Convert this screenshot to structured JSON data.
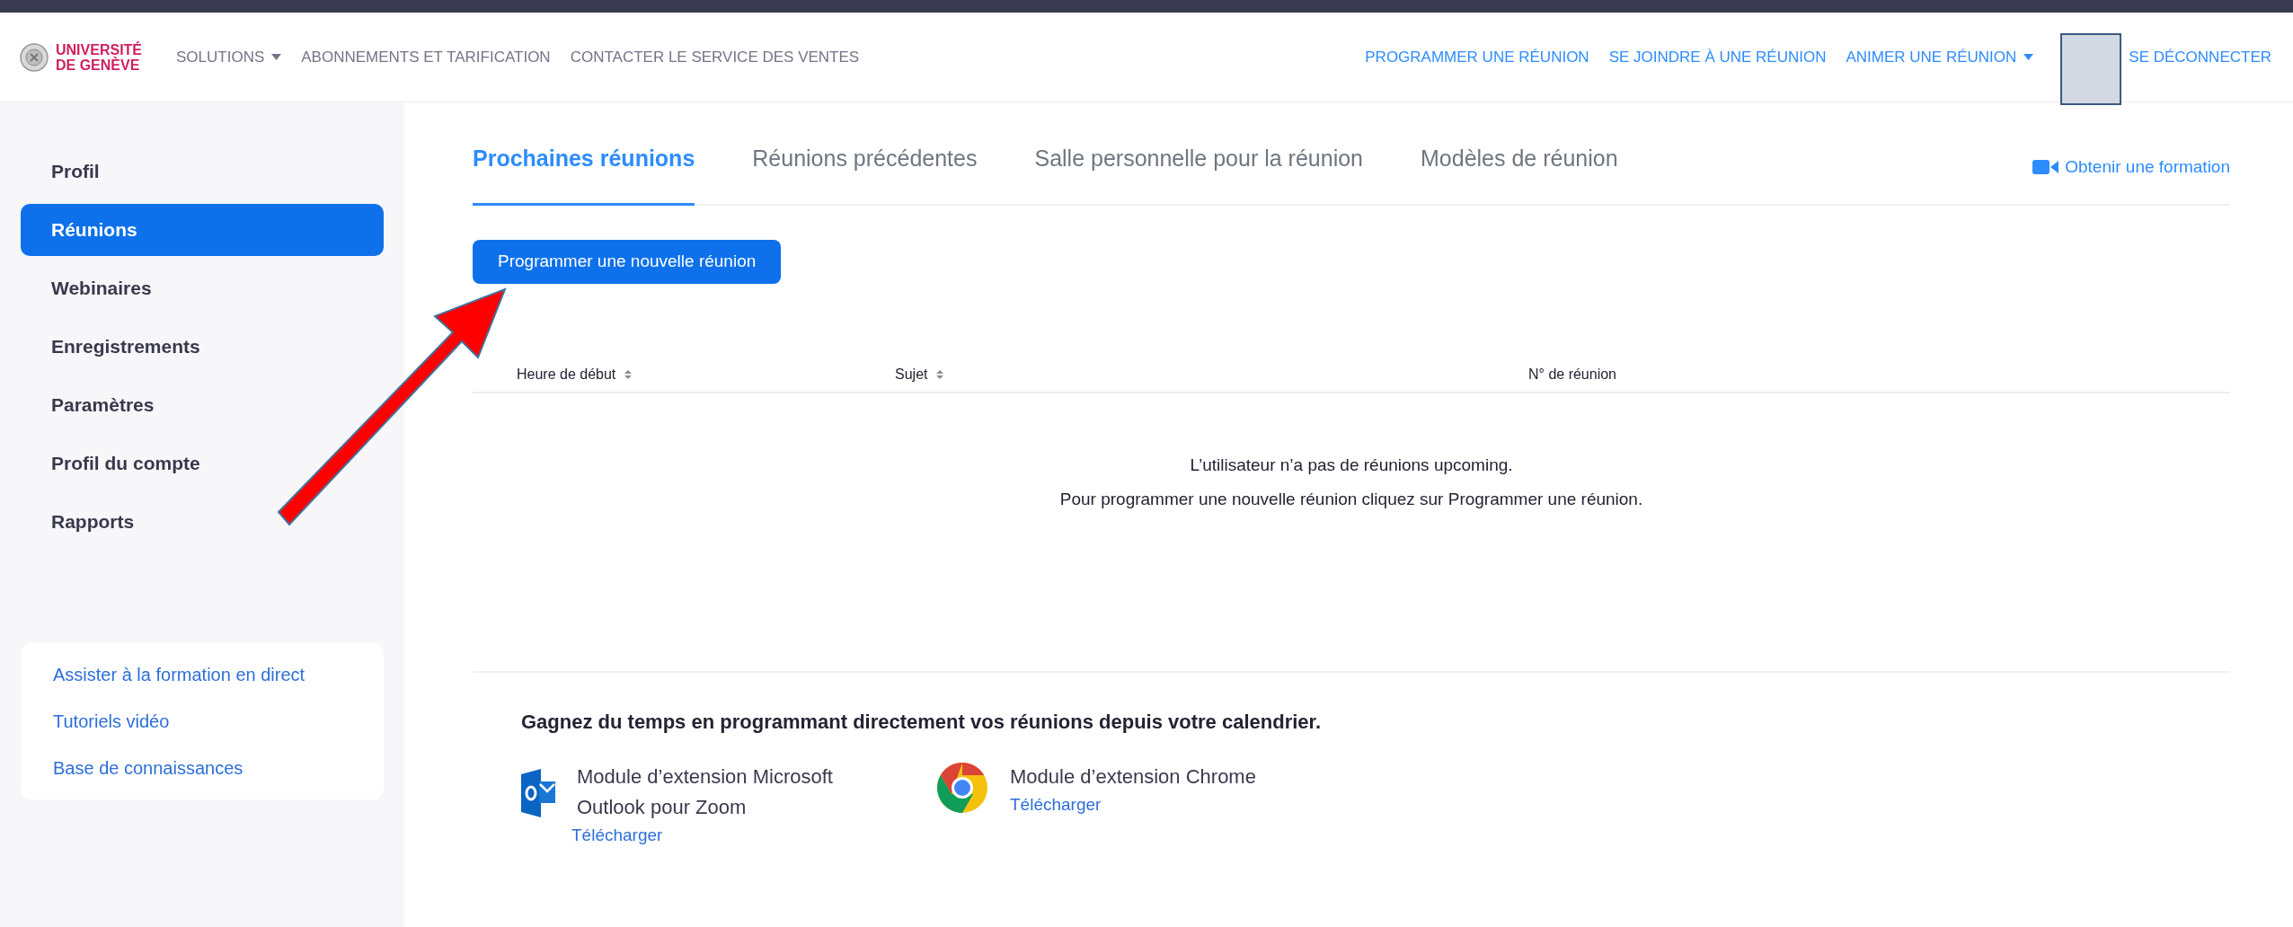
{
  "header": {
    "logo": [
      "UNIVERSITÉ",
      "DE GENÈVE"
    ],
    "left_nav": [
      {
        "label": "SOLUTIONS",
        "dropdown": true
      },
      {
        "label": "ABONNEMENTS ET TARIFICATION",
        "dropdown": false
      },
      {
        "label": "CONTACTER LE SERVICE DES VENTES",
        "dropdown": false
      }
    ],
    "right_nav": [
      {
        "label": "PROGRAMMER UNE RÉUNION",
        "dropdown": false
      },
      {
        "label": "SE JOINDRE À UNE RÉUNION",
        "dropdown": false
      },
      {
        "label": "ANIMER UNE RÉUNION",
        "dropdown": true
      }
    ],
    "signout": "SE DÉCONNECTER"
  },
  "sidebar": {
    "items": [
      {
        "label": "Profil",
        "selected": false
      },
      {
        "label": "Réunions",
        "selected": true
      },
      {
        "label": "Webinaires",
        "selected": false
      },
      {
        "label": "Enregistrements",
        "selected": false
      },
      {
        "label": "Paramètres",
        "selected": false
      },
      {
        "label": "Profil du compte",
        "selected": false
      },
      {
        "label": "Rapports",
        "selected": false
      }
    ],
    "help_links": [
      "Assister à la formation en direct",
      "Tutoriels vidéo",
      "Base de connaissances"
    ]
  },
  "tabs": [
    {
      "label": "Prochaines réunions",
      "selected": true
    },
    {
      "label": "Réunions précédentes",
      "selected": false
    },
    {
      "label": "Salle personnelle pour la réunion",
      "selected": false
    },
    {
      "label": "Modèles de réunion",
      "selected": false
    }
  ],
  "training_link": "Obtenir une formation",
  "new_meeting_button": "Programmer une nouvelle réunion",
  "table": {
    "columns": [
      {
        "label": "Heure de début",
        "sortable": true
      },
      {
        "label": "Sujet",
        "sortable": true
      },
      {
        "label": "N° de réunion",
        "sortable": false
      }
    ],
    "empty_message": [
      "L’utilisateur n’a pas de réunions upcoming.",
      "Pour programmer une nouvelle réunion cliquez sur Programmer une réunion."
    ]
  },
  "calendar": {
    "heading": "Gagnez du temps en programmant directement vos réunions depuis votre calendrier.",
    "plugins": [
      {
        "kind": "outlook",
        "name": "Module d’extension Microsoft Outlook pour Zoom",
        "link": "Télécharger"
      },
      {
        "kind": "chrome",
        "name": "Module d’extension Chrome",
        "link": "Télécharger"
      }
    ]
  }
}
